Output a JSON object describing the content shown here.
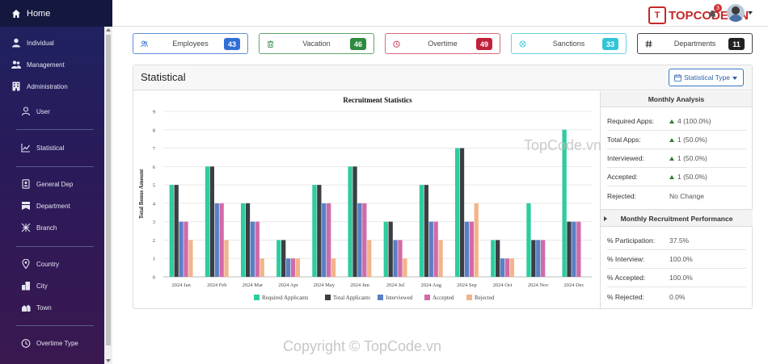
{
  "sidebar": {
    "home": "Home",
    "items": [
      {
        "label": "Individual",
        "icon": "user-solid-icon"
      },
      {
        "label": "Management",
        "icon": "users-icon"
      },
      {
        "label": "Administration",
        "icon": "building-icon"
      },
      {
        "label": "User",
        "icon": "user-icon"
      },
      {
        "label": "Statistical",
        "icon": "chart-line-icon"
      },
      {
        "label": "General Dep",
        "icon": "id-card-icon"
      },
      {
        "label": "Department",
        "icon": "bookmark-icon"
      },
      {
        "label": "Branch",
        "icon": "branch-icon"
      },
      {
        "label": "Country",
        "icon": "map-pin-icon"
      },
      {
        "label": "City",
        "icon": "city-icon"
      },
      {
        "label": "Town",
        "icon": "town-icon"
      },
      {
        "label": "Overtime Type",
        "icon": "clock-icon"
      }
    ]
  },
  "topbar": {
    "logo_text": "TOPCODE.VN",
    "logo_mark": "T",
    "notification_count": "3"
  },
  "cards": [
    {
      "label": "Employees",
      "value": "43",
      "color": "#2f6fd6",
      "border": "#5b8ed8",
      "icon": "users-icon"
    },
    {
      "label": "Vacation",
      "value": "46",
      "color": "#2e8b3e",
      "border": "#5fa86a",
      "icon": "trash-icon"
    },
    {
      "label": "Overtime",
      "value": "49",
      "color": "#c0213b",
      "border": "#d66a7a",
      "icon": "clock-icon"
    },
    {
      "label": "Sanctions",
      "value": "33",
      "color": "#32c5d8",
      "border": "#6bd3e0",
      "icon": "ban-icon"
    },
    {
      "label": "Departments",
      "value": "11",
      "color": "#222222",
      "border": "#444444",
      "icon": "hashtag-icon"
    }
  ],
  "panel": {
    "title": "Statistical",
    "dropdown_label": "Statistical Type"
  },
  "chart_data": {
    "type": "bar",
    "title": "Recruitment Statistics",
    "ylabel": "Total Bonus Amount",
    "xlabel": "",
    "ylim": [
      0,
      9
    ],
    "yticks": [
      "0",
      "1",
      "2",
      "3",
      "4",
      "5",
      "6",
      "7",
      "8",
      "9"
    ],
    "grid": true,
    "legend_position": "bottom",
    "categories": [
      "2024 Jan",
      "2024 Feb",
      "2024 Mar",
      "2024 Apr",
      "2024 May",
      "2024 Jun",
      "2024 Jul",
      "2024 Aug",
      "2024 Sep",
      "2024 Oct",
      "2024 Nov",
      "2024 Dec"
    ],
    "series": [
      {
        "name": "Required Applicants",
        "color": "#2ecc9f",
        "values": [
          5,
          6,
          4,
          2,
          5,
          6,
          3,
          5,
          7,
          2,
          4,
          8
        ]
      },
      {
        "name": "Total Applicants",
        "color": "#3a3f44",
        "values": [
          5,
          6,
          4,
          2,
          5,
          6,
          3,
          5,
          7,
          2,
          2,
          3
        ]
      },
      {
        "name": "Interviewed",
        "color": "#5b7fc4",
        "values": [
          3,
          4,
          3,
          1,
          4,
          4,
          2,
          3,
          3,
          1,
          2,
          3
        ]
      },
      {
        "name": "Accepted",
        "color": "#d16aa8",
        "values": [
          3,
          4,
          3,
          1,
          4,
          4,
          2,
          3,
          3,
          1,
          2,
          3
        ]
      },
      {
        "name": "Rejected",
        "color": "#f2b48a",
        "values": [
          2,
          2,
          1,
          1,
          1,
          2,
          1,
          2,
          4,
          1,
          0,
          0
        ]
      }
    ]
  },
  "monthly_analysis": {
    "title": "Monthly Analysis",
    "rows": [
      {
        "label": "Required Apps:",
        "value": "4 (100.0%)",
        "up": true
      },
      {
        "label": "Total Apps:",
        "value": "1 (50.0%)",
        "up": true
      },
      {
        "label": "Interviewed:",
        "value": "1 (50.0%)",
        "up": true
      },
      {
        "label": "Accepted:",
        "value": "1 (50.0%)",
        "up": true
      },
      {
        "label": "Rejected:",
        "value": "No Change",
        "up": false
      }
    ]
  },
  "recruitment_performance": {
    "title": "Monthly Recruitment Performance",
    "rows": [
      {
        "label": "% Participation:",
        "value": "37.5%"
      },
      {
        "label": "% Interview:",
        "value": "100.0%"
      },
      {
        "label": "% Accepted:",
        "value": "100.0%"
      },
      {
        "label": "% Rejected:",
        "value": "0.0%"
      }
    ]
  },
  "watermark": {
    "bottom": "Copyright © TopCode.vn",
    "middle": "TopCode.vn"
  }
}
